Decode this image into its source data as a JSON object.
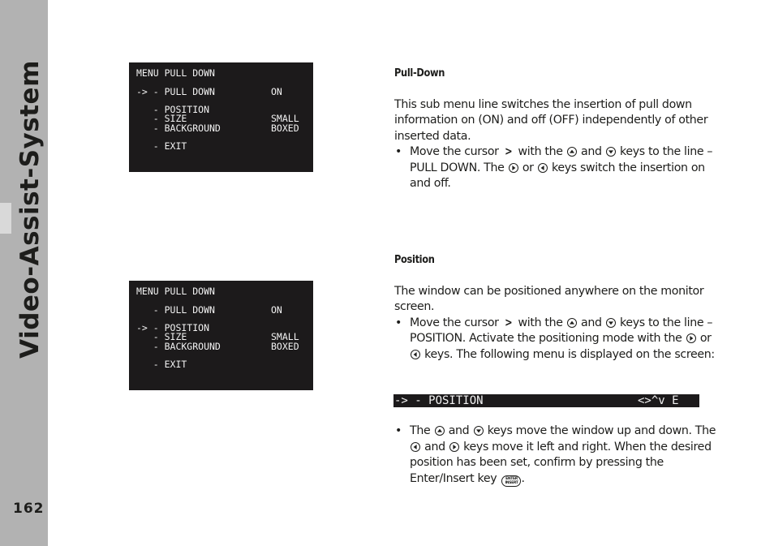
{
  "sidebar": {
    "title": "Video-Assist-System",
    "page_number": "162"
  },
  "screen1": {
    "lines": [
      {
        "label": "MENU PULL DOWN",
        "value": ""
      },
      {
        "label": "-> - PULL DOWN",
        "value": "ON"
      },
      {
        "label": "   - POSITION",
        "value": ""
      },
      {
        "label": "   - SIZE",
        "value": "SMALL"
      },
      {
        "label": "   - BACKGROUND",
        "value": "BOXED"
      },
      {
        "label": "   - EXIT",
        "value": ""
      }
    ]
  },
  "screen2": {
    "lines": [
      {
        "label": "MENU PULL DOWN",
        "value": ""
      },
      {
        "label": "   - PULL DOWN",
        "value": "ON"
      },
      {
        "label": "-> - POSITION",
        "value": ""
      },
      {
        "label": "   - SIZE",
        "value": "SMALL"
      },
      {
        "label": "   - BACKGROUND",
        "value": "BOXED"
      },
      {
        "label": "   - EXIT",
        "value": ""
      }
    ]
  },
  "section_pulldown": {
    "heading": "Pull-Down",
    "paragraph": "This sub menu line switches the insertion of pull down information on (ON) and off (OFF) independently of other inserted data.",
    "bullet": {
      "t1": "Move the cursor",
      "t2": "with the",
      "t3": "and",
      "t4": "keys to the line – PULL DOWN. The",
      "t5": "or",
      "t6": "keys switch the insertion on and off."
    }
  },
  "section_position": {
    "heading": "Position",
    "paragraph": "The window can be positioned anywhere on the monitor screen.",
    "bullet": {
      "t1": "Move the cursor",
      "t2": "with the",
      "t3": "and",
      "t4": "keys to the line – POSITION. Activate the positioning mode with the",
      "t5": "or",
      "t6": "keys. The following menu is displayed on the screen:"
    },
    "position_bar": {
      "left": "-> - POSITION",
      "right": "<>^v E"
    },
    "bullet2": {
      "t1": "The",
      "t2": "and",
      "t3": "keys move the window up and down. The",
      "t4": "and",
      "t5": "keys move it left and right. When the desired position has been set, confirm by pressing the Enter/Insert key",
      "t6": "."
    }
  },
  "glyphs": {
    "bullet": "•",
    "cursor": ">",
    "enter_key_top": "ENTER",
    "enter_key_bottom": "INSERT"
  }
}
